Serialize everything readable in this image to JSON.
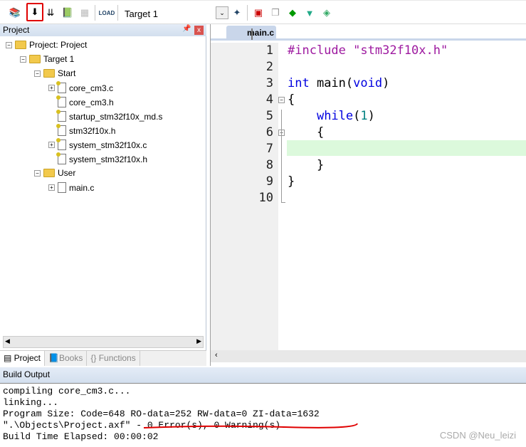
{
  "toolbar": {
    "target": "Target 1",
    "icons": [
      "translate-icon",
      "build-icon",
      "rebuild-icon",
      "batch-build-icon",
      "stop-build-icon",
      "load-icon",
      "target-dropdown",
      "target-options-icon",
      "manage-components-icon",
      "manage-books-icon",
      "select-packs-icon",
      "pack-installer-icon",
      "run-env-icon"
    ],
    "highlight_color": "#e00000"
  },
  "project": {
    "title": "Project",
    "tree": [
      {
        "label": "Project: Project",
        "level": 0
      },
      {
        "label": "Target 1",
        "level": 1
      },
      {
        "label": "Start",
        "level": 2
      },
      {
        "label": "core_cm3.c",
        "level": 3
      },
      {
        "label": "core_cm3.h",
        "level": 3
      },
      {
        "label": "startup_stm32f10x_md.s",
        "level": 3
      },
      {
        "label": "stm32f10x.h",
        "level": 3
      },
      {
        "label": "system_stm32f10x.c",
        "level": 3
      },
      {
        "label": "system_stm32f10x.h",
        "level": 3
      },
      {
        "label": "User",
        "level": 2
      },
      {
        "label": "main.c",
        "level": 3
      }
    ],
    "tabs": [
      "Project",
      "Books",
      "{} Functions"
    ]
  },
  "editor": {
    "tab": "main.c",
    "lines": [
      "1",
      "2",
      "3",
      "4",
      "5",
      "6",
      "7",
      "8",
      "9",
      "10"
    ],
    "current_line": 7
  },
  "build": {
    "title": "Build Output",
    "lines": [
      "compiling core_cm3.c...",
      "linking...",
      "Program Size: Code=648 RO-data=252 RW-data=0 ZI-data=1632",
      "\".\\Objects\\Project.axf\" - 0 Error(s), 0 Warning(s).",
      "Build Time Elapsed:  00:00:02"
    ]
  },
  "watermark": "CSDN @Neu_leizi"
}
